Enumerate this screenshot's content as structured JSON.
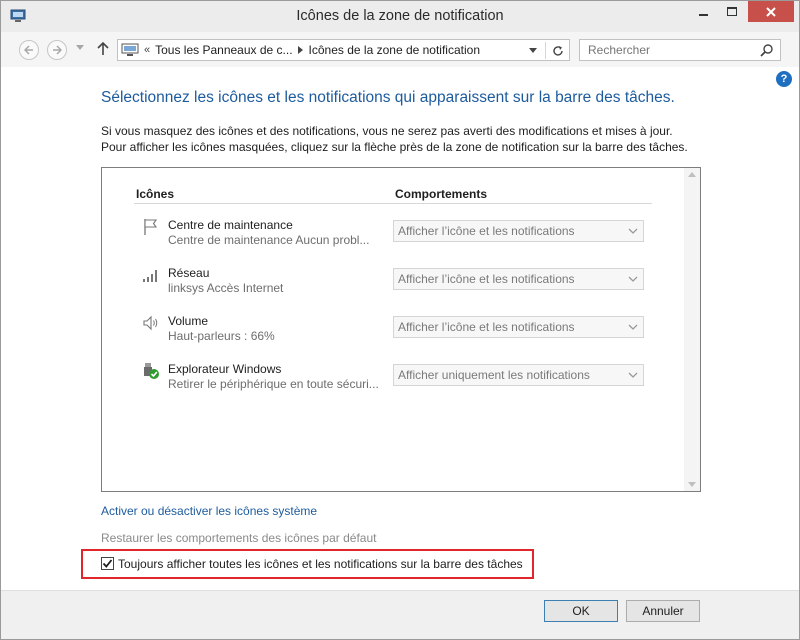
{
  "window": {
    "title": "Icônes de la zone de notification"
  },
  "address": {
    "crumb_prefix": "«",
    "crumbs": [
      "Tous les Panneaux de c...",
      "Icônes de la zone de notification"
    ]
  },
  "search": {
    "placeholder": "Rechercher"
  },
  "help": {
    "label": "?"
  },
  "main": {
    "heading": "Sélectionnez les icônes et les notifications qui apparaissent sur la barre des tâches.",
    "description": "Si vous masquez des icônes et des notifications, vous ne serez pas averti des modifications et mises à jour. Pour afficher les icônes masquées, cliquez sur la flèche près de la zone de notification sur la barre des tâches.",
    "columns": {
      "icons": "Icônes",
      "behaviors": "Comportements"
    },
    "rows": [
      {
        "name": "Centre de maintenance",
        "sub": "Centre de maintenance  Aucun probl...",
        "behavior": "Afficher l’icône et les notifications",
        "icon": "flag-icon"
      },
      {
        "name": "Réseau",
        "sub": "linksys Accès Internet",
        "behavior": "Afficher l’icône et les notifications",
        "icon": "network-signal-icon"
      },
      {
        "name": "Volume",
        "sub": "Haut-parleurs : 66%",
        "behavior": "Afficher l’icône et les notifications",
        "icon": "speaker-icon"
      },
      {
        "name": "Explorateur Windows",
        "sub": "Retirer le périphérique en toute sécuri...",
        "behavior": "Afficher uniquement les notifications",
        "icon": "usb-safe-remove-icon"
      }
    ],
    "link_system_icons": "Activer ou désactiver les icônes système",
    "link_restore": "Restaurer les comportements des icônes par défaut",
    "always_show_label": "Toujours afficher toutes les icônes et les notifications sur la barre des tâches",
    "always_show_checked": true
  },
  "footer": {
    "ok": "OK",
    "cancel": "Annuler"
  },
  "colors": {
    "heading": "#1d5b9d",
    "close_button": "#c7504a",
    "highlight": "#e0262b"
  }
}
